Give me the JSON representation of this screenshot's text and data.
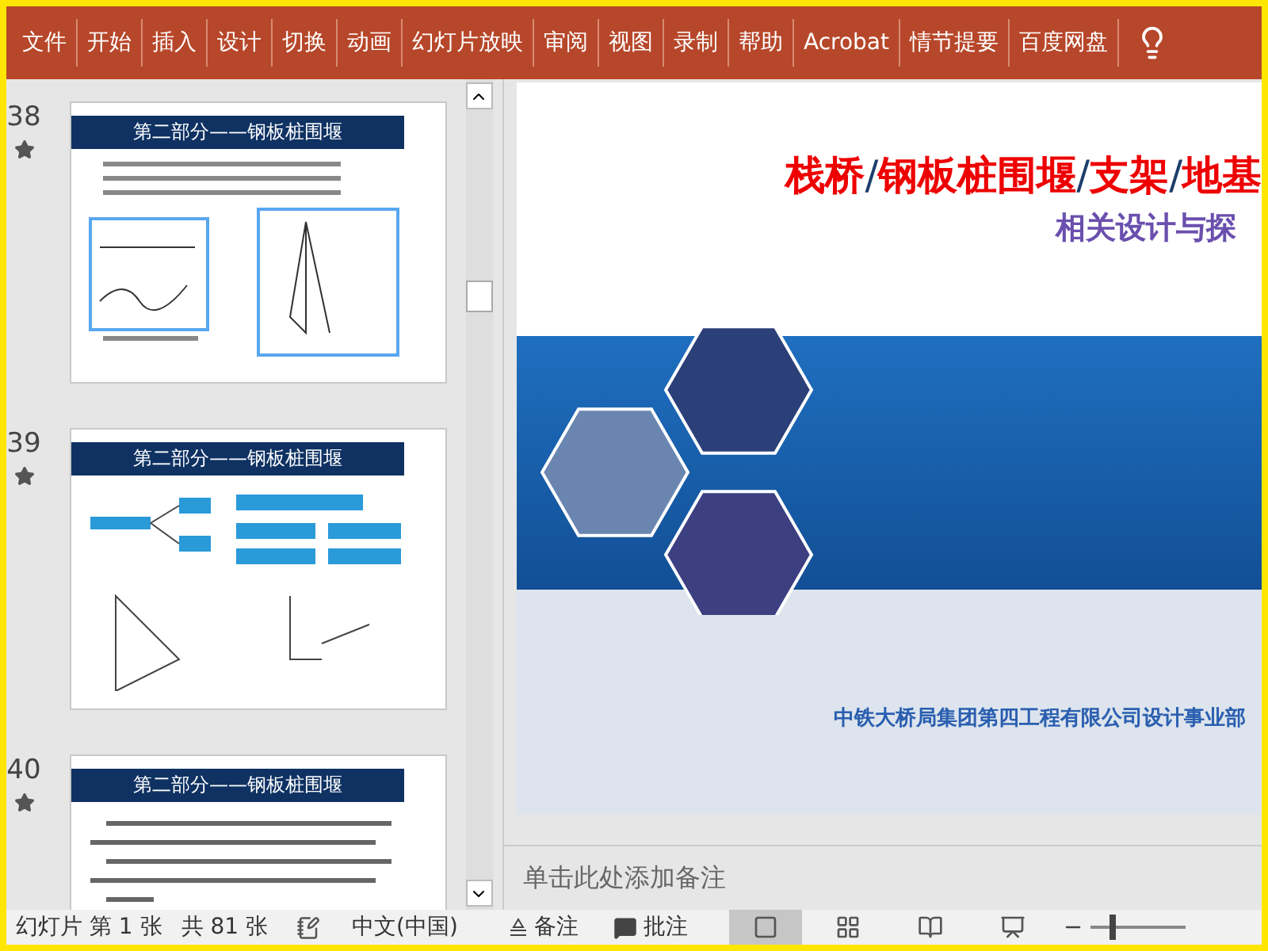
{
  "ribbon": {
    "tabs": [
      "文件",
      "开始",
      "插入",
      "设计",
      "切换",
      "动画",
      "幻灯片放映",
      "审阅",
      "视图",
      "录制",
      "帮助",
      "Acrobat",
      "情节提要",
      "百度网盘"
    ]
  },
  "thumbnails": [
    {
      "number": "38",
      "has_animation": true,
      "title": "第二部分——钢板桩围堰",
      "kind": "figures"
    },
    {
      "number": "39",
      "has_animation": true,
      "title": "第二部分——钢板桩围堰",
      "kind": "mindmap"
    },
    {
      "number": "40",
      "has_animation": true,
      "title": "第二部分——钢板桩围堰",
      "kind": "bullets"
    }
  ],
  "slide": {
    "title": [
      {
        "text": "栈桥",
        "kind": "term"
      },
      {
        "text": "/",
        "kind": "separator"
      },
      {
        "text": "钢板桩围堰",
        "kind": "term"
      },
      {
        "text": "/",
        "kind": "separator"
      },
      {
        "text": "支架",
        "kind": "term"
      },
      {
        "text": "/",
        "kind": "separator"
      },
      {
        "text": "地基",
        "kind": "term"
      }
    ],
    "subtitle": "相关设计与探",
    "footer": "中铁大桥局集团第四工程有限公司设计事业部"
  },
  "notes": {
    "placeholder": "单击此处添加备注"
  },
  "status_bar": {
    "slide_number": "幻灯片 第 1 张",
    "slide_count": "共 81 张",
    "language": "中文(中国)",
    "notes_button": "备注",
    "comments_button": "批注",
    "views": [
      {
        "kind": "normal",
        "selected": true
      },
      {
        "kind": "sorter",
        "selected": false
      },
      {
        "kind": "reading",
        "selected": false
      },
      {
        "kind": "slideshow",
        "selected": false
      }
    ],
    "zoom": {
      "level": 0.2
    }
  }
}
